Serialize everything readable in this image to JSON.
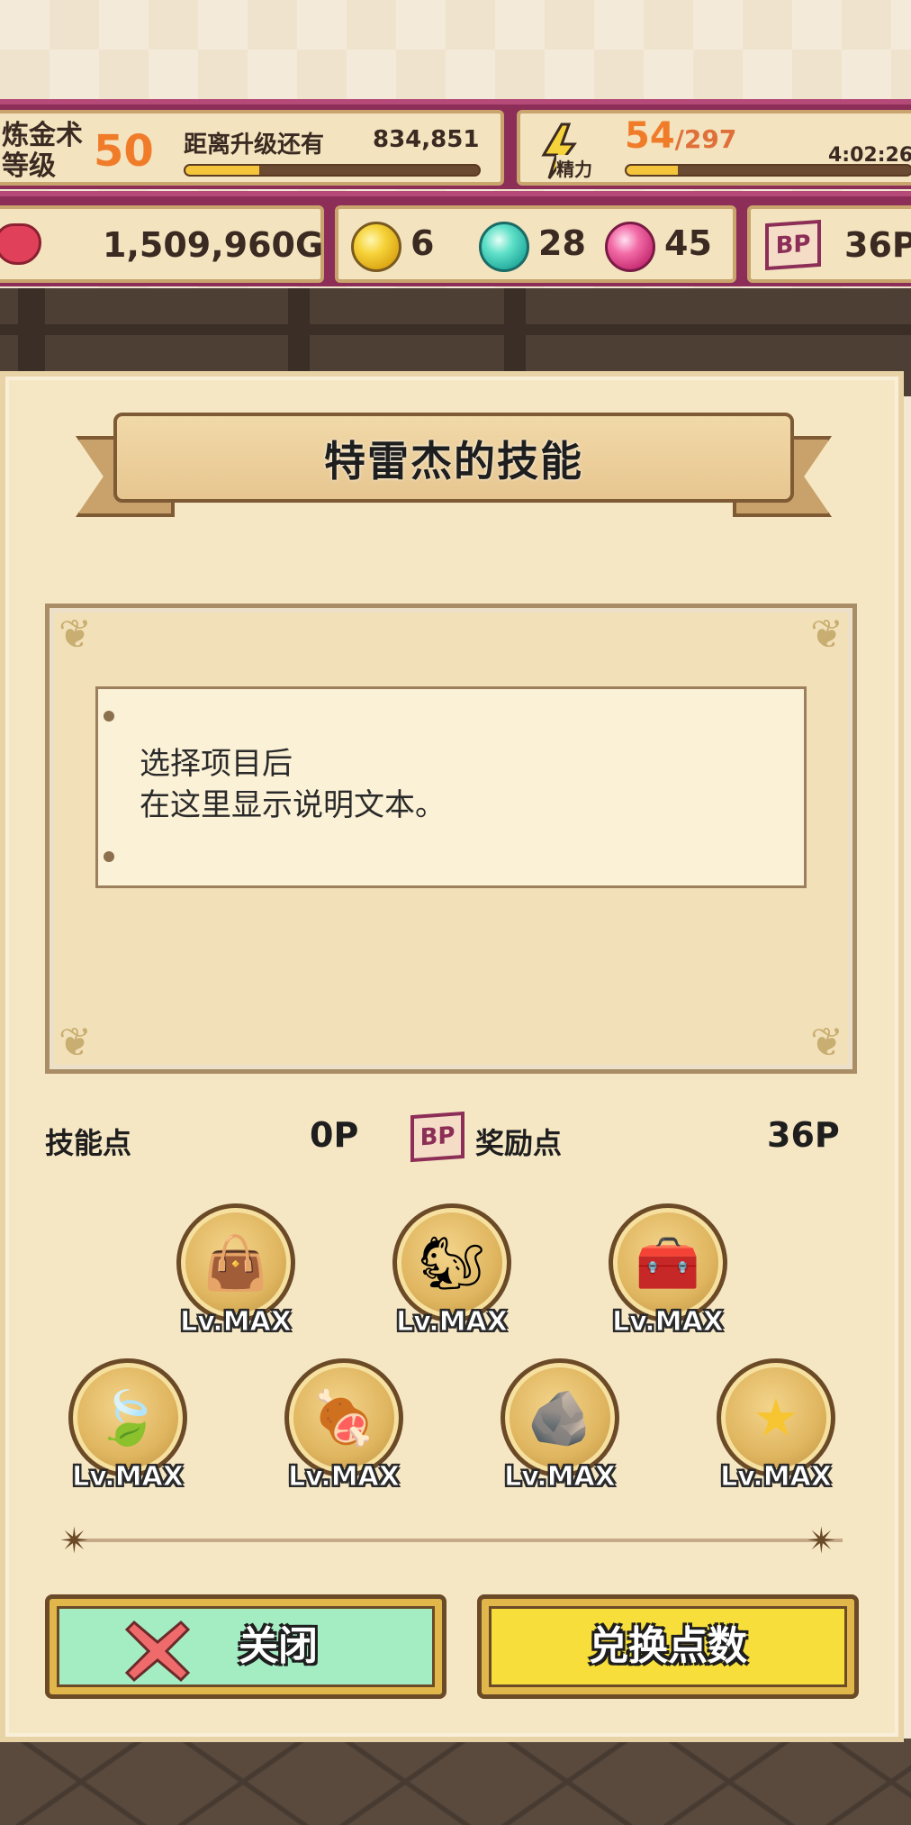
{
  "status": {
    "level_label_line1": "炼金术",
    "level_label_line2": "等级",
    "level": "50",
    "to_next_label": "距离升级还有",
    "exp_remaining": "834,851",
    "exp_progress": 0.25,
    "stamina_tag": "精力",
    "stamina_current": "54",
    "stamina_max": "/297",
    "stamina_progress": 0.18,
    "stamina_timer": "4:02:26"
  },
  "currency": {
    "gold": "1,509,960G",
    "gem_yellow": "6",
    "gem_cyan": "28",
    "gem_pink": "45",
    "bp_badge": "BP",
    "bp_points": "36P"
  },
  "dialog": {
    "title": "特雷杰的技能",
    "description_line1": "选择项目后",
    "description_line2": "在这里显示说明文本。",
    "skill_points_label": "技能点",
    "skill_points_value": "0P",
    "bonus_badge": "BP",
    "bonus_points_label": "奖励点",
    "bonus_points_value": "36P",
    "skills": [
      {
        "icon": "bag-icon",
        "level": "Lv.MAX"
      },
      {
        "icon": "squirrel-icon",
        "level": "Lv.MAX"
      },
      {
        "icon": "treasure-chest-icon",
        "level": "Lv.MAX"
      },
      {
        "icon": "leaf-icon",
        "level": "Lv.MAX"
      },
      {
        "icon": "meat-icon",
        "level": "Lv.MAX"
      },
      {
        "icon": "ore-icon",
        "level": "Lv.MAX"
      },
      {
        "icon": "star-icon",
        "level": "Lv.MAX"
      }
    ],
    "close_label": "关闭",
    "exchange_label": "兑换点数"
  },
  "colors": {
    "accent_orange": "#f07c2a",
    "bar_magenta": "#8c2e57",
    "close_button_bg": "#a4edc3",
    "exchange_button_bg": "#f7de3a"
  }
}
